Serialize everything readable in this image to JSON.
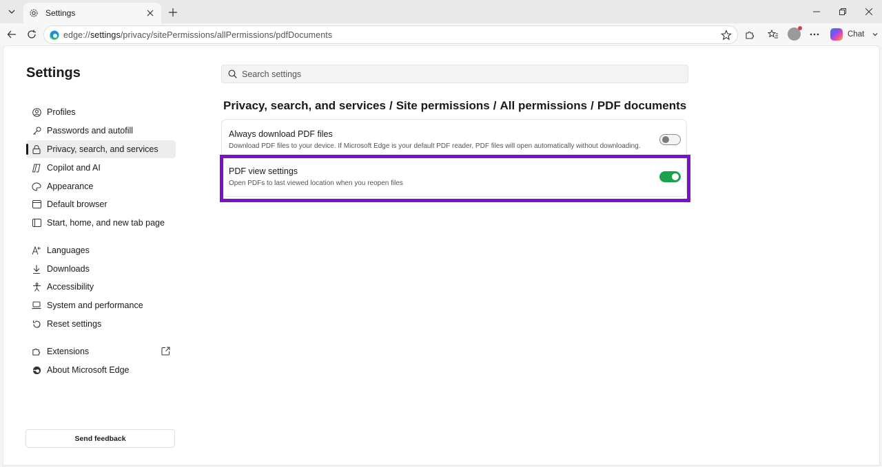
{
  "browser": {
    "tab": {
      "title": "Settings",
      "close_icon": "close-icon",
      "icon": "gear-icon"
    },
    "new_tab_icon": "plus-icon",
    "address": {
      "url_prefix": "edge://",
      "url_bold": "settings",
      "url_rest": "/privacy/sitePermissions/allPermissions/pdfDocuments"
    },
    "chat_label": "Chat"
  },
  "sidebar": {
    "title": "Settings",
    "items": [
      {
        "label": "Profiles",
        "icon": "profile-icon"
      },
      {
        "label": "Passwords and autofill",
        "icon": "key-icon"
      },
      {
        "label": "Privacy, search, and services",
        "icon": "lock-icon",
        "active": true
      },
      {
        "label": "Copilot and AI",
        "icon": "copilot-icon"
      },
      {
        "label": "Appearance",
        "icon": "palette-icon"
      },
      {
        "label": "Default browser",
        "icon": "browser-icon"
      },
      {
        "label": "Start, home, and new tab page",
        "icon": "home-icon"
      },
      {
        "label": "Languages",
        "icon": "language-icon"
      },
      {
        "label": "Downloads",
        "icon": "download-icon"
      },
      {
        "label": "Accessibility",
        "icon": "accessibility-icon"
      },
      {
        "label": "System and performance",
        "icon": "laptop-icon"
      },
      {
        "label": "Reset settings",
        "icon": "reset-icon"
      },
      {
        "label": "Extensions",
        "icon": "extensions-icon"
      },
      {
        "label": "About Microsoft Edge",
        "icon": "edge-icon"
      }
    ],
    "feedback_label": "Send feedback"
  },
  "main": {
    "search_placeholder": "Search settings",
    "breadcrumb": [
      "Privacy, search, and services",
      "Site permissions",
      "All permissions",
      "PDF documents"
    ],
    "settings": [
      {
        "title": "Always download PDF files",
        "description": "Download PDF files to your device. If Microsoft Edge is your default PDF reader, PDF files will open automatically without downloading.",
        "enabled": false
      },
      {
        "title": "PDF view settings",
        "description": "Open PDFs to last viewed location when you reopen files",
        "enabled": true
      }
    ],
    "highlight_color": "#7b12c9",
    "toggle_on_color": "#1aa34a"
  }
}
